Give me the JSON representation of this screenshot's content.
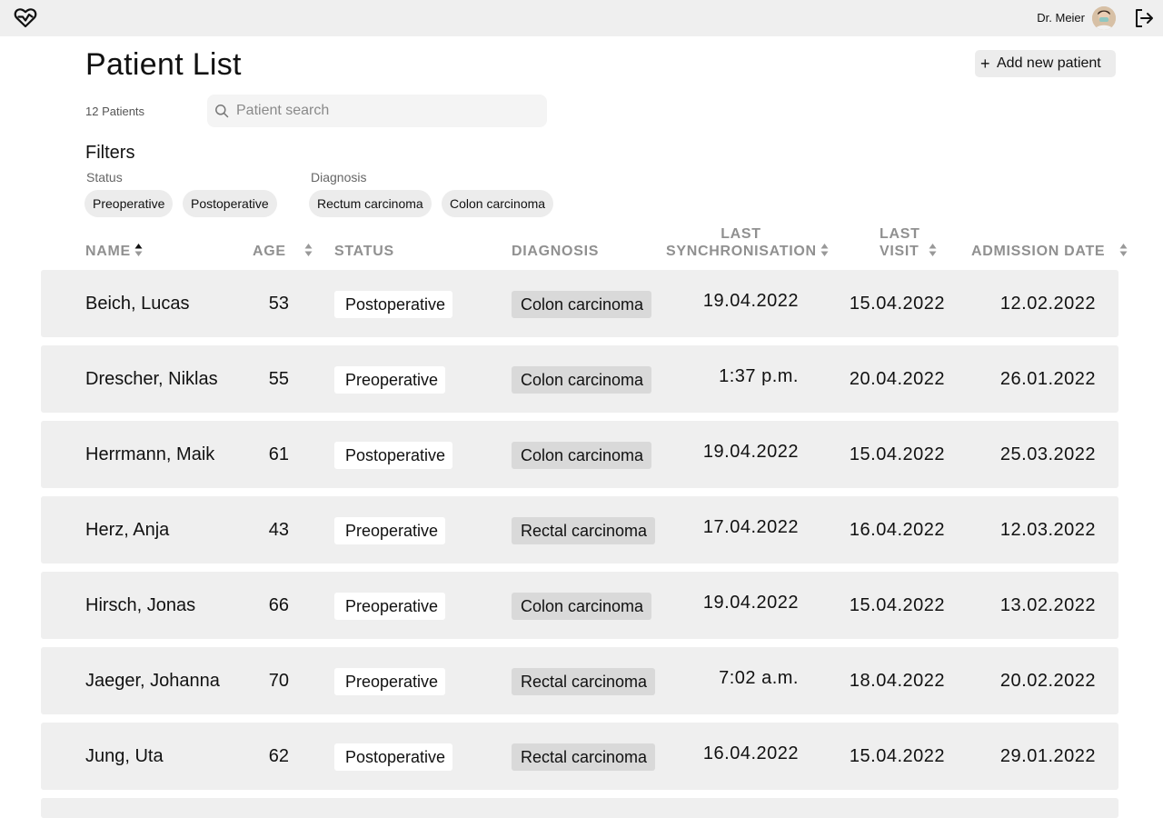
{
  "header": {
    "logo_icon": "heart-logo-icon",
    "doctor_name": "Dr. Meier",
    "avatar_icon": "doctor-avatar",
    "logout_icon": "logout-icon"
  },
  "page": {
    "title": "Patient List",
    "add_button_label": "Add new patient",
    "add_button_icon": "plus-icon",
    "patient_count": "12 Patients",
    "search_placeholder": "Patient search",
    "search_value": ""
  },
  "filters": {
    "title": "Filters",
    "status_label": "Status",
    "status_options": [
      "Preoperative",
      "Postoperative"
    ],
    "diagnosis_label": "Diagnosis",
    "diagnosis_options": [
      "Rectum carcinoma",
      "Colon carcinoma"
    ]
  },
  "table": {
    "columns": {
      "name": "NAME",
      "age": "AGE",
      "status": "STATUS",
      "diagnosis": "DIAGNOSIS",
      "last_sync_line1": "LAST",
      "last_sync_line2": "SYNCHRONISATION",
      "last_visit_line1": "LAST",
      "last_visit_line2": "VISIT",
      "admission_date": "ADMISSION DATE"
    },
    "active_sort": "name-ascending",
    "rows": [
      {
        "name": "Beich, Lucas",
        "age": "53",
        "status": "Postoperative",
        "diagnosis": "Colon carcinoma",
        "last_sync": "19.04.2022",
        "last_visit": "15.04.2022",
        "admission": "12.02.2022"
      },
      {
        "name": "Drescher, Niklas",
        "age": "55",
        "status": "Preoperative",
        "diagnosis": "Colon carcinoma",
        "last_sync": "1:37 p.m.",
        "last_visit": "20.04.2022",
        "admission": "26.01.2022"
      },
      {
        "name": "Herrmann, Maik",
        "age": "61",
        "status": "Postoperative",
        "diagnosis": "Colon carcinoma",
        "last_sync": "19.04.2022",
        "last_visit": "15.04.2022",
        "admission": "25.03.2022"
      },
      {
        "name": "Herz, Anja",
        "age": "43",
        "status": "Preoperative",
        "diagnosis": "Rectal carcinoma",
        "last_sync": "17.04.2022",
        "last_visit": "16.04.2022",
        "admission": "12.03.2022"
      },
      {
        "name": "Hirsch, Jonas",
        "age": "66",
        "status": "Preoperative",
        "diagnosis": "Colon carcinoma",
        "last_sync": "19.04.2022",
        "last_visit": "15.04.2022",
        "admission": "13.02.2022"
      },
      {
        "name": "Jaeger, Johanna",
        "age": "70",
        "status": "Preoperative",
        "diagnosis": "Rectal carcinoma",
        "last_sync": "7:02 a.m.",
        "last_visit": "18.04.2022",
        "admission": "20.02.2022"
      },
      {
        "name": "Jung, Uta",
        "age": "62",
        "status": "Postoperative",
        "diagnosis": "Rectal carcinoma",
        "last_sync": "16.04.2022",
        "last_visit": "15.04.2022",
        "admission": "29.01.2022"
      }
    ]
  }
}
